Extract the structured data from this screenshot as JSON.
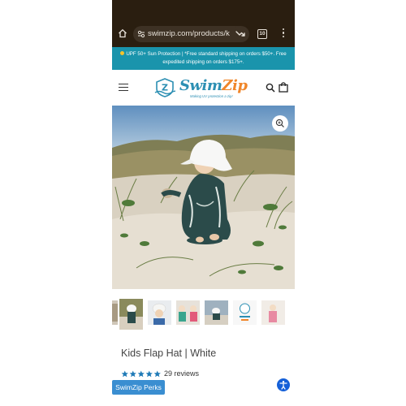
{
  "browser": {
    "url": "swimzip.com/products/k",
    "tab_count": "10"
  },
  "announcement": {
    "text": "UPF 50+ Sun Protection | *Free standard shipping on orders $50+. Free expedited shipping on orders $175+."
  },
  "header": {
    "logo_swim": "Swim",
    "logo_zip": "Zip",
    "logo_tagline": "Making UV protection a zip!"
  },
  "product": {
    "title": "Kids Flap Hat | White",
    "rating": 5,
    "reviews_label": "29 reviews",
    "thumbnail_count": 7,
    "active_thumbnail": 4
  },
  "perks": {
    "label": "SwimZip Perks"
  },
  "colors": {
    "browser_chrome": "#2a1e10",
    "announcement_bar": "#1a94ac",
    "brand_blue": "#2c8fb3",
    "brand_orange": "#f0862a",
    "star": "#1f7ab7",
    "perks_button": "#3a8ed1",
    "accessibility_button": "#1560d8"
  },
  "icons": [
    "home-icon",
    "site-settings-icon",
    "trend-icon",
    "tabs-icon",
    "more-icon",
    "menu-icon",
    "search-icon",
    "cart-icon",
    "zoom-icon",
    "star-icon",
    "accessibility-icon"
  ]
}
